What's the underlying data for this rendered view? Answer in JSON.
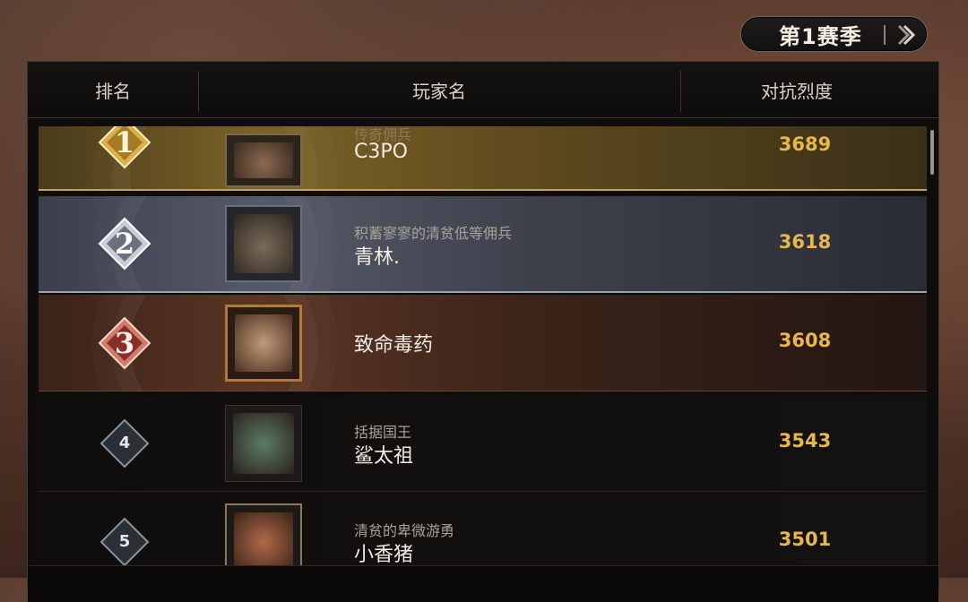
{
  "season": {
    "label": "第1赛季",
    "next_icon": "chevron-right-icon"
  },
  "header": {
    "rank": "排名",
    "player": "玩家名",
    "score": "对抗烈度"
  },
  "rows": [
    {
      "rank": "1",
      "title": "传奇佣兵",
      "name": "C3PO",
      "score": "3689",
      "tier": "gold"
    },
    {
      "rank": "2",
      "title": "积蓄寥寥的清贫低等佣兵",
      "name": "青林.",
      "score": "3618",
      "tier": "silver"
    },
    {
      "rank": "3",
      "title": "",
      "name": "致命毒药",
      "score": "3608",
      "tier": "bronze"
    },
    {
      "rank": "4",
      "title": "括据国王",
      "name": "鲨太祖",
      "score": "3543",
      "tier": "plain"
    },
    {
      "rank": "5",
      "title": "清贫的卑微游勇",
      "name": "小香猪",
      "score": "3501",
      "tier": "plain"
    }
  ],
  "colors": {
    "score": "#e7b64c",
    "gold": "#c9a44a",
    "silver": "#9aa3b5",
    "bronze": "#b0504a"
  }
}
